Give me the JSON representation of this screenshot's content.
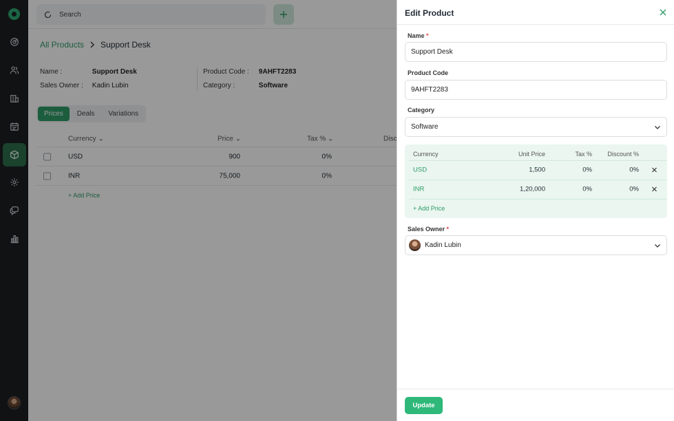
{
  "colors": {
    "accent": "#2e9b67",
    "sidebar": "#1d1f22",
    "table_bg": "#eaf6ef",
    "required": "#e0474c"
  },
  "sidebar": {
    "items": [
      {
        "icon": "target-icon"
      },
      {
        "icon": "users-icon"
      },
      {
        "icon": "building-icon"
      },
      {
        "icon": "calendar-icon"
      },
      {
        "icon": "box-icon",
        "active": true
      },
      {
        "icon": "gear-icon"
      },
      {
        "icon": "chat-icon"
      },
      {
        "icon": "bar-chart-icon"
      }
    ]
  },
  "topbar": {
    "search_placeholder": "Search"
  },
  "breadcrumb": {
    "parent": "All Products",
    "current": "Support Desk"
  },
  "product_info": {
    "name_label": "Name :",
    "name_value": "Support Desk",
    "owner_label": "Sales Owner :",
    "owner_value": "Kadin Lubin",
    "code_label": "Product Code :",
    "code_value": "9AHFT2283",
    "category_label": "Category :",
    "category_value": "Software"
  },
  "tabs": [
    "Prices",
    "Deals",
    "Variations"
  ],
  "bg_table": {
    "headers": {
      "currency": "Currency",
      "price": "Price",
      "tax": "Tax %",
      "discount": "Disco"
    },
    "rows": [
      {
        "currency": "USD",
        "price": "900",
        "tax": "0%"
      },
      {
        "currency": "INR",
        "price": "75,000",
        "tax": "0%"
      }
    ],
    "add_label": "+ Add Price"
  },
  "drawer": {
    "title": "Edit Product",
    "name_label": "Name",
    "name_value": "Support Desk",
    "code_label": "Product Code",
    "code_value": "9AHFT2283",
    "category_label": "Category",
    "category_value": "Software",
    "price_table": {
      "headers": {
        "currency": "Currency",
        "unit_price": "Unit Price",
        "tax": "Tax %",
        "discount": "Discount %"
      },
      "rows": [
        {
          "currency": "USD",
          "unit_price": "1,500",
          "tax": "0%",
          "discount": "0%"
        },
        {
          "currency": "INR",
          "unit_price": "1,20,000",
          "tax": "0%",
          "discount": "0%"
        }
      ],
      "add_label": "+ Add Price"
    },
    "owner_label": "Sales Owner",
    "owner_value": "Kadin Lubin",
    "required_mark": "*",
    "update_label": "Update"
  }
}
